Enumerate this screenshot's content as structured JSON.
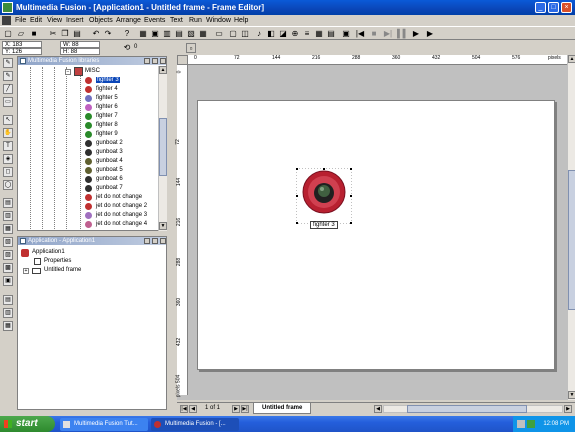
{
  "window": {
    "title": "Multimedia Fusion - [Application1 - Untitled frame - Frame Editor]",
    "min": "_",
    "max": "□",
    "close": "×"
  },
  "menu": [
    "File",
    "Edit",
    "View",
    "Insert",
    "Objects",
    "Arrange",
    "Events",
    "Text",
    "Run",
    "Window",
    "Help"
  ],
  "position": {
    "x_label": "X: 183",
    "y_label": "Y: 126",
    "w_label": "W: 88",
    "h_label": "H: 88",
    "angle": "0"
  },
  "libraries": {
    "title": "Multimedia Fusion libraries",
    "folder": "MISC",
    "items": [
      {
        "label": "fighter 3",
        "color": "#c03030",
        "selected": true
      },
      {
        "label": "fighter 4",
        "color": "#c03030"
      },
      {
        "label": "fighter 5",
        "color": "#7070c0"
      },
      {
        "label": "fighter 6",
        "color": "#c060c0"
      },
      {
        "label": "fighter 7",
        "color": "#2a8a2a"
      },
      {
        "label": "fighter 8",
        "color": "#2a8a2a"
      },
      {
        "label": "fighter 9",
        "color": "#2a8a2a"
      },
      {
        "label": "gunboat 2",
        "color": "#303030"
      },
      {
        "label": "gunboat 3",
        "color": "#303030"
      },
      {
        "label": "gunboat 4",
        "color": "#606030"
      },
      {
        "label": "gunboat 5",
        "color": "#606030"
      },
      {
        "label": "gunboat 6",
        "color": "#303030"
      },
      {
        "label": "gunboat 7",
        "color": "#303030"
      },
      {
        "label": "jet do not change",
        "color": "#c03030"
      },
      {
        "label": "jet do not change 2",
        "color": "#c03030"
      },
      {
        "label": "jet do not change 3",
        "color": "#a070c0"
      },
      {
        "label": "jet do not change 4",
        "color": "#c06090"
      }
    ]
  },
  "workspace": {
    "title": "Application - Application1",
    "items": [
      {
        "label": "Application1"
      },
      {
        "label": "Properties"
      },
      {
        "label": "Untitled frame"
      }
    ]
  },
  "ruler": {
    "h_ticks": [
      "0",
      "72",
      "144",
      "216",
      "288",
      "360",
      "432",
      "504",
      "576"
    ],
    "h_unit": "pixels",
    "v_ticks": [
      "0",
      "72",
      "144",
      "216",
      "288",
      "360",
      "432"
    ],
    "v_unit": "pixels 504"
  },
  "object": {
    "label": "fighter 3"
  },
  "frame_tabs": {
    "page": "1 of 1",
    "tab": "Untitled frame"
  },
  "taskbar": {
    "start": "start",
    "items": [
      "Multimedia Fusion Tut...",
      "Multimedia Fusion - [..."
    ],
    "clock": "12:08 PM"
  }
}
